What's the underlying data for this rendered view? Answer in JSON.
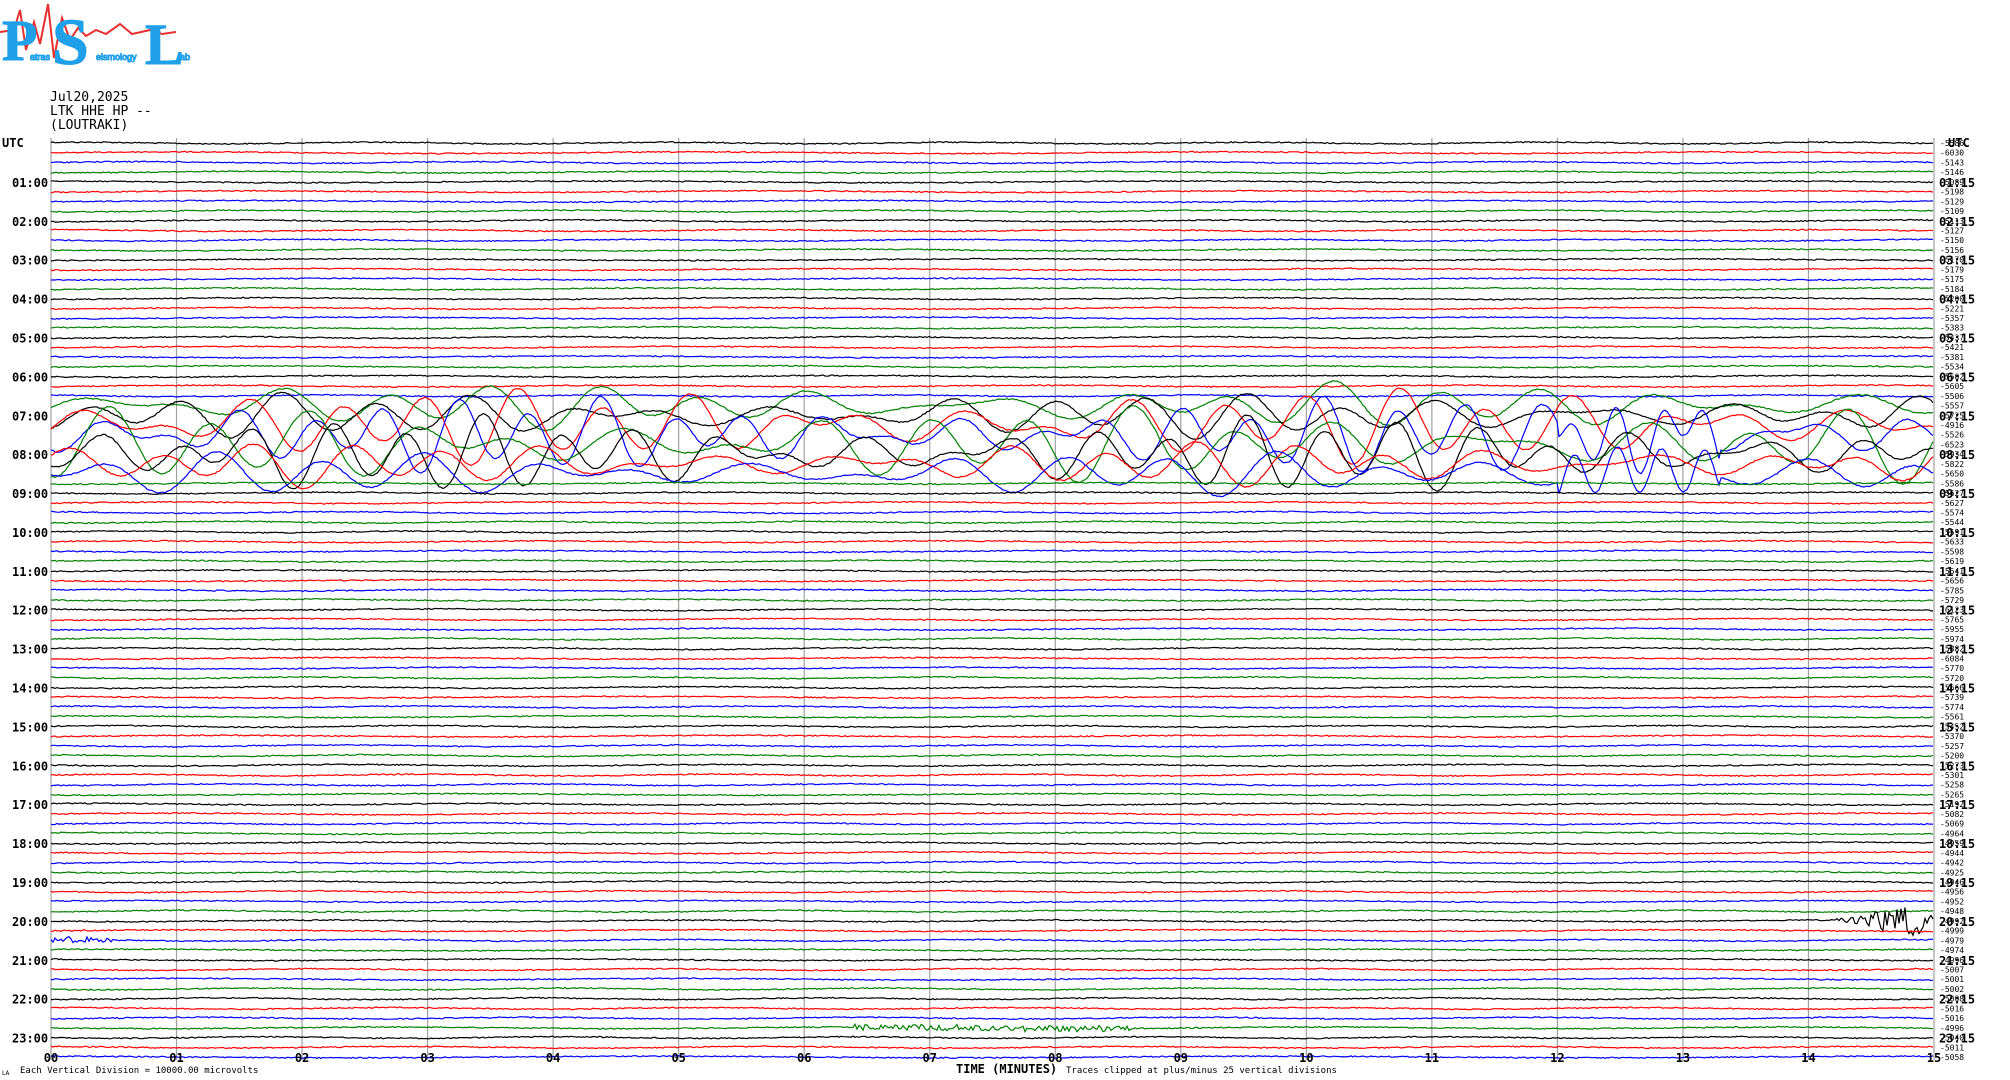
{
  "header": {
    "date": "Jul20,2025",
    "station": "LTK HHE HP --",
    "location": "(LOUTRAKI)"
  },
  "logo": {
    "letters": [
      "P",
      "S",
      "L"
    ],
    "words": [
      "atras",
      "eismology",
      "ab"
    ],
    "color": "#1fa0e8",
    "wave_color": "#e83030"
  },
  "footer": {
    "scale_note": "Each Vertical Division = 10000.00 microvolts",
    "clip_note": "Traces clipped at plus/minus 25 vertical divisions",
    "corner_mark": "LA"
  },
  "chart_data": {
    "type": "line",
    "title": "",
    "xlabel": "TIME (MINUTES)",
    "ylabel": "",
    "left_label": "UTC",
    "right_label": "UTC",
    "x_ticks": [
      "00",
      "01",
      "02",
      "03",
      "04",
      "05",
      "06",
      "07",
      "08",
      "09",
      "10",
      "11",
      "12",
      "13",
      "14",
      "15"
    ],
    "xlim": [
      0,
      15
    ],
    "left_hour_labels": [
      "01:00",
      "02:00",
      "03:00",
      "04:00",
      "05:00",
      "06:00",
      "07:00",
      "08:00",
      "09:00",
      "10:00",
      "11:00",
      "12:00",
      "13:00",
      "14:00",
      "15:00",
      "16:00",
      "17:00",
      "18:00",
      "19:00",
      "20:00",
      "21:00",
      "22:00",
      "23:00"
    ],
    "right_hour_labels": [
      "01:15",
      "02:15",
      "03:15",
      "04:15",
      "05:15",
      "06:15",
      "07:15",
      "08:15",
      "09:15",
      "10:15",
      "11:15",
      "12:15",
      "13:15",
      "14:15",
      "15:15",
      "16:15",
      "17:15",
      "18:15",
      "19:15",
      "20:15",
      "21:15",
      "22:15",
      "23:15"
    ],
    "trace_colors": [
      "#000000",
      "#ff0000",
      "#0000ff",
      "#008000"
    ],
    "grid_color": "#a0a0a0",
    "trace_offsets": [
      "-5586",
      "-6030",
      "-5143",
      "-5146",
      "-5089",
      "-5198",
      "-5129",
      "-5109",
      "-5113",
      "-5127",
      "-5150",
      "-5156",
      "-5170",
      "-5179",
      "-5175",
      "-5184",
      "-5200",
      "-5221",
      "-5357",
      "-5383",
      "-5437",
      "-5421",
      "-5381",
      "-5534",
      "-5502",
      "-5605",
      "-5506",
      "-5557",
      "-5725",
      "-4916",
      "-5526",
      "-6523",
      "-5934",
      "-5822",
      "-5650",
      "-5586",
      "-5627",
      "-5627",
      "-5574",
      "-5544",
      "-5591",
      "-5633",
      "-5598",
      "-5619",
      "-5641",
      "-5656",
      "-5785",
      "-5729",
      "-6123",
      "-5765",
      "-5955",
      "-5974",
      "-5882",
      "-6084",
      "-5770",
      "-5720",
      "-5666",
      "-5739",
      "-5774",
      "-5561",
      "-5452",
      "-5370",
      "-5257",
      "-5200",
      "-5273",
      "-5301",
      "-5258",
      "-5265",
      "-5192",
      "-5082",
      "-5069",
      "-4964",
      "-4959",
      "-4944",
      "-4942",
      "-4925",
      "-4946",
      "-4956",
      "-4952",
      "-4948",
      "-4992",
      "-4999",
      "-4979",
      "-4974",
      "-4996",
      "-5007",
      "-5001",
      "-5002",
      "-5008",
      "-5016",
      "-5016",
      "-4996",
      "-5040",
      "-5011",
      "-5058"
    ],
    "events": [
      {
        "trace_start": 27,
        "trace_end": 34,
        "type": "teleseism"
      },
      {
        "trace": 80,
        "start_min": 14.2,
        "end_min": 15.0,
        "type": "local"
      },
      {
        "trace": 82,
        "start_min": 0.0,
        "end_min": 0.5,
        "type": "noise"
      },
      {
        "trace": 91,
        "start_min": 6.4,
        "end_min": 8.6,
        "type": "noise"
      }
    ]
  }
}
